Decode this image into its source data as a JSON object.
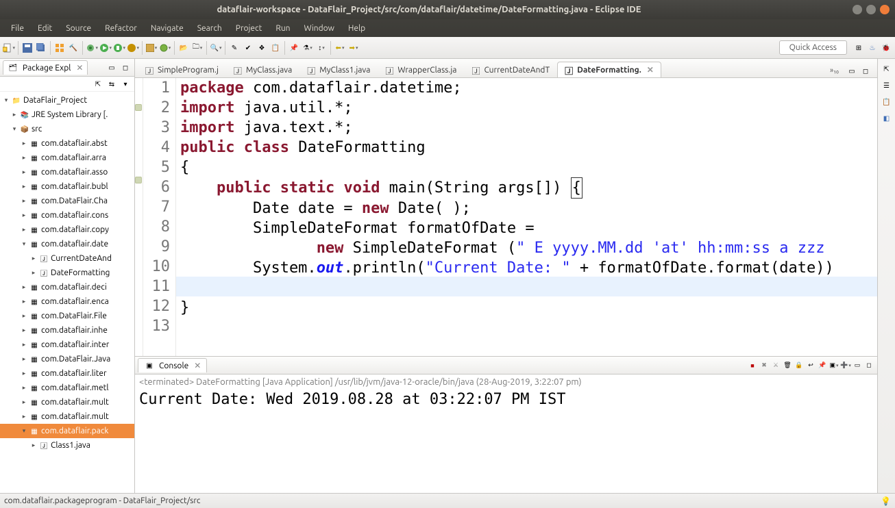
{
  "titlebar": {
    "title": "dataflair-workspace - DataFlair_Project/src/com/dataflair/datetime/DateFormatting.java - Eclipse IDE"
  },
  "menu": [
    "File",
    "Edit",
    "Source",
    "Refactor",
    "Navigate",
    "Search",
    "Project",
    "Run",
    "Window",
    "Help"
  ],
  "quick_access": "Quick Access",
  "package_explorer": {
    "title": "Package Expl",
    "project": "DataFlair_Project",
    "jre": "JRE System Library [.",
    "src": "src",
    "packages": [
      "com.dataflair.abst",
      "com.dataflair.arra",
      "com.dataflair.asso",
      "com.dataflair.bubl",
      "com.DataFlair.Cha",
      "com.dataflair.cons",
      "com.dataflair.copy"
    ],
    "open_pkg": "com.dataflair.date",
    "open_files": [
      "CurrentDateAnd",
      "DateFormatting"
    ],
    "packages2": [
      "com.dataflair.deci",
      "com.dataflair.enca",
      "com.DataFlair.File",
      "com.dataflair.inhe",
      "com.dataflair.inter",
      "com.DataFlair.Java",
      "com.dataflair.liter",
      "com.dataflair.metl",
      "com.dataflair.mult",
      "com.dataflair.mult"
    ],
    "selected_pkg": "com.dataflair.pack",
    "selected_file": "Class1.java"
  },
  "editor_tabs": [
    {
      "label": "SimpleProgram.j",
      "active": false
    },
    {
      "label": "MyClass.java",
      "active": false
    },
    {
      "label": "MyClass1.java",
      "active": false
    },
    {
      "label": "WrapperClass.ja",
      "active": false
    },
    {
      "label": "CurrentDateAndT",
      "active": false
    },
    {
      "label": "DateFormatting.",
      "active": true
    }
  ],
  "editor_more": "»₁₀",
  "code": {
    "lines": [
      "1",
      "2",
      "3",
      "4",
      "5",
      "6",
      "7",
      "8",
      "9",
      "10",
      "11",
      "12",
      "13"
    ],
    "l1_kw": "package",
    "l1_rest": " com.dataflair.datetime;",
    "l2_kw": "import",
    "l2_rest": " java.util.*;",
    "l3_kw": "import",
    "l3_rest": " java.text.*;",
    "l4_kw1": "public",
    "l4_kw2": "class",
    "l4_name": " DateFormatting",
    "l5": "{",
    "l6_ind": "    ",
    "l6_kw1": "public",
    "l6_kw2": "static",
    "l6_kw3": "void",
    "l6_main": " main(String args[]) ",
    "l6_brace": "{",
    "l7": "        Date date = ",
    "l7_kw": "new",
    "l7_rest": " Date( );",
    "l8": "        SimpleDateFormat formatOfDate =",
    "l9": "               ",
    "l9_kw": "new",
    "l9_rest": " SimpleDateFormat (",
    "l9_str": "\" E yyyy.MM.dd 'at' hh:mm:ss a zzz",
    "l10a": "        System.",
    "l10_out": "out",
    "l10b": ".println(",
    "l10_str": "\"Current Date: \"",
    "l10c": " + formatOfDate.format(date))",
    "l11": "      }",
    "l12": "}",
    "l13": ""
  },
  "console": {
    "title": "Console",
    "status": "<terminated> DateFormatting [Java Application] /usr/lib/jvm/java-12-oracle/bin/java (28-Aug-2019, 3:22:07 pm)",
    "output": "Current Date:  Wed 2019.08.28 at 03:22:07 PM IST"
  },
  "statusbar": "com.dataflair.packageprogram - DataFlair_Project/src"
}
